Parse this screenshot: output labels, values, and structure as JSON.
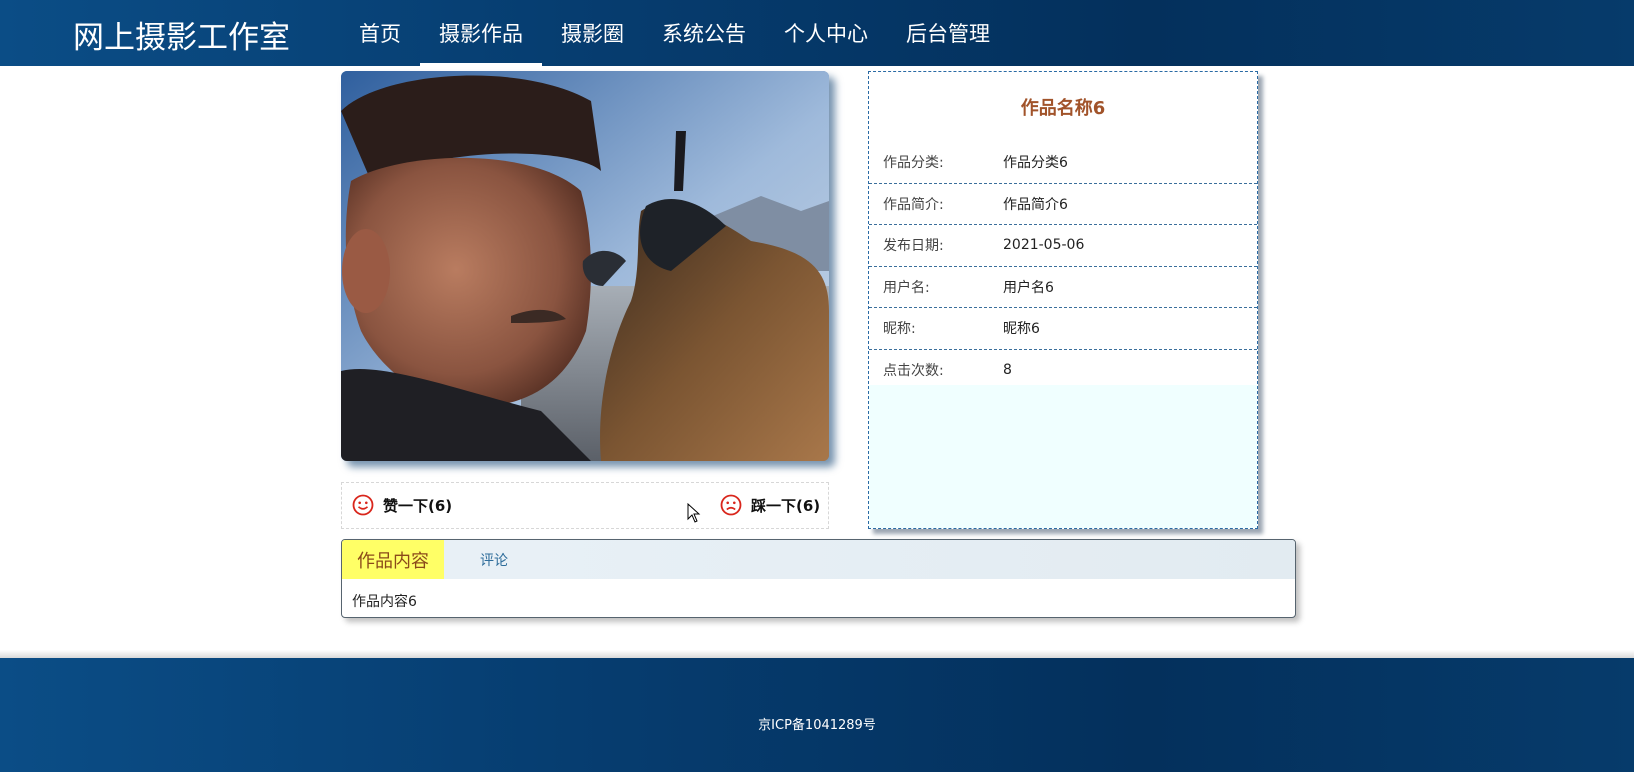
{
  "header": {
    "site_title": "网上摄影工作室",
    "nav": [
      {
        "label": "首页",
        "active": false
      },
      {
        "label": "摄影作品",
        "active": true
      },
      {
        "label": "摄影圈",
        "active": false
      },
      {
        "label": "系统公告",
        "active": false
      },
      {
        "label": "个人中心",
        "active": false
      },
      {
        "label": "后台管理",
        "active": false
      }
    ]
  },
  "votes": {
    "like_label": "赞一下(6)",
    "dislike_label": "踩一下(6)",
    "icon_color": "#d9261c"
  },
  "info": {
    "title": "作品名称6",
    "rows": [
      {
        "label": "作品分类:",
        "value": "作品分类6"
      },
      {
        "label": "作品简介:",
        "value": "作品简介6"
      },
      {
        "label": "发布日期:",
        "value": "2021-05-06"
      },
      {
        "label": "用户名:",
        "value": "用户名6"
      },
      {
        "label": "昵称:",
        "value": "昵称6"
      },
      {
        "label": "点击次数:",
        "value": "8"
      }
    ]
  },
  "tabs": {
    "items": [
      {
        "label": "作品内容",
        "active": true
      },
      {
        "label": "评论",
        "active": false
      }
    ],
    "content": "作品内容6"
  },
  "footer": {
    "icp": "京ICP备1041289号"
  },
  "colors": {
    "header_bg": "#063d70",
    "title_accent": "#a1532a",
    "active_tab_bg": "#ffff66",
    "panel_fill": "#f0ffff"
  }
}
